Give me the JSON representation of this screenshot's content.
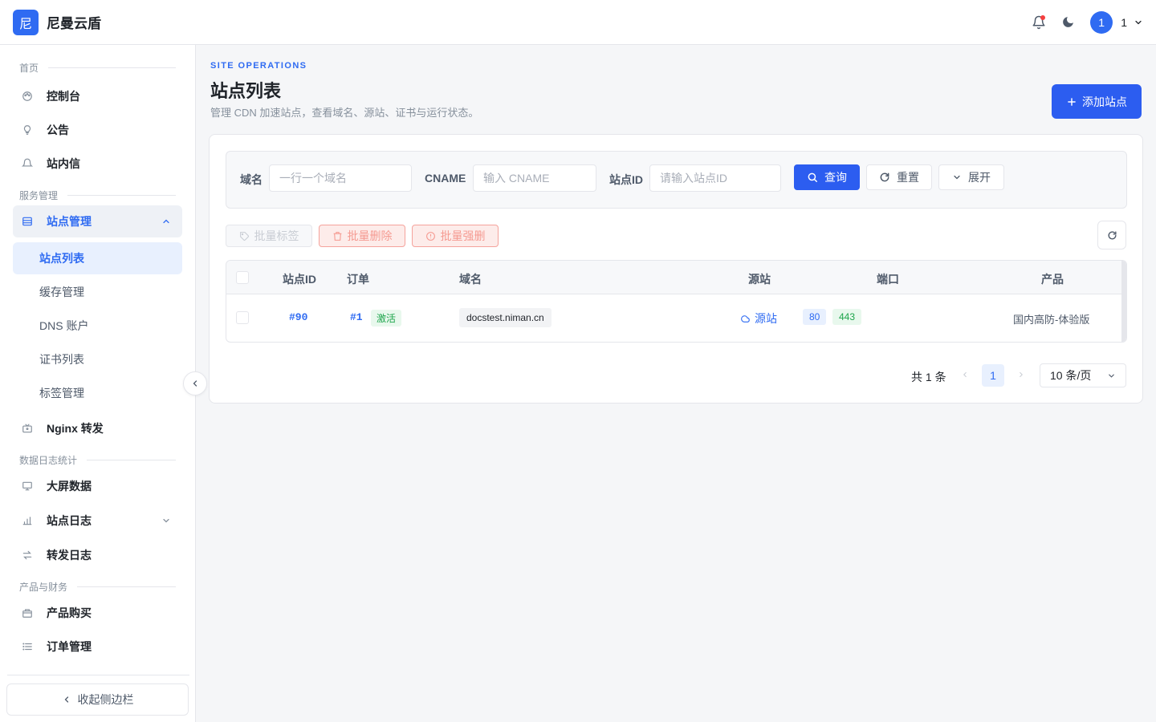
{
  "header": {
    "logo_char": "尼",
    "brand": "尼曼云盾",
    "user_avatar": "1",
    "user_name": "1"
  },
  "sidebar": {
    "sec_home": "首页",
    "item_console": "控制台",
    "item_notice": "公告",
    "item_inbox": "站内信",
    "sec_service": "服务管理",
    "item_site_mgmt": "站点管理",
    "sub_site_list": "站点列表",
    "sub_cache": "缓存管理",
    "sub_dns": "DNS 账户",
    "sub_cert": "证书列表",
    "sub_tags": "标签管理",
    "item_nginx": "Nginx 转发",
    "sec_stats": "数据日志统计",
    "item_bigscreen": "大屏数据",
    "item_site_logs": "站点日志",
    "item_forward_logs": "转发日志",
    "sec_finance": "产品与财务",
    "item_buy": "产品购买",
    "item_orders": "订单管理",
    "collapse_label": "收起侧边栏"
  },
  "main": {
    "eyebrow": "SITE OPERATIONS",
    "title": "站点列表",
    "desc": "管理 CDN 加速站点，查看域名、源站、证书与运行状态。",
    "add_button": "添加站点"
  },
  "filter": {
    "domain_label": "域名",
    "domain_placeholder": "一行一个域名",
    "cname_label": "CNAME",
    "cname_placeholder": "输入 CNAME",
    "siteid_label": "站点ID",
    "siteid_placeholder": "请输入站点ID",
    "search_button": "查询",
    "reset_button": "重置",
    "expand_button": "展开"
  },
  "batch": {
    "tag": "批量标签",
    "delete": "批量删除",
    "force_delete": "批量强删"
  },
  "table": {
    "columns": [
      "站点ID",
      "订单",
      "域名",
      "源站",
      "端口",
      "产品"
    ],
    "rows": [
      {
        "site_id": "#90",
        "order": "#1",
        "status": "激活",
        "domain": "docstest.niman.cn",
        "origin": "源站",
        "port_http": "80",
        "port_https": "443",
        "product": "国内高防-体验版"
      }
    ]
  },
  "pagination": {
    "total": "共 1 条",
    "current_page": "1",
    "page_size": "10 条/页"
  },
  "colors": {
    "primary": "#2f6bf2",
    "success": "#1ea54c",
    "danger": "#f53f3f"
  }
}
